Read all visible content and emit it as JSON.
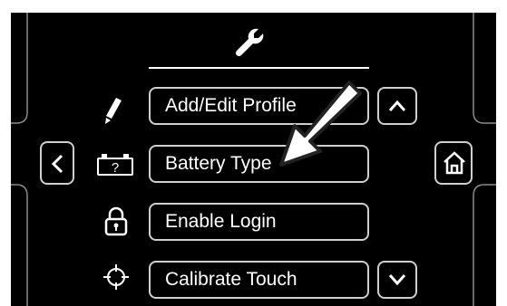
{
  "menu": {
    "items": [
      {
        "label": "Add/Edit Profile",
        "icon": "pencil-icon"
      },
      {
        "label": "Battery Type",
        "icon": "battery-question-icon"
      },
      {
        "label": "Enable Login",
        "icon": "padlock-icon"
      },
      {
        "label": "Calibrate Touch",
        "icon": "crosshair-icon"
      }
    ]
  },
  "header": {
    "icon": "wrench-icon"
  },
  "nav": {
    "back_icon": "chevron-left-icon",
    "home_icon": "home-icon",
    "scroll_up_icon": "chevron-up-icon",
    "scroll_down_icon": "chevron-down-icon"
  },
  "annotation": {
    "icon": "arrow-pointer-icon"
  },
  "colors": {
    "background": "#000000",
    "foreground": "#ffffff",
    "button_border": "#cfcfcf",
    "frame_line": "#8a8a8a"
  }
}
